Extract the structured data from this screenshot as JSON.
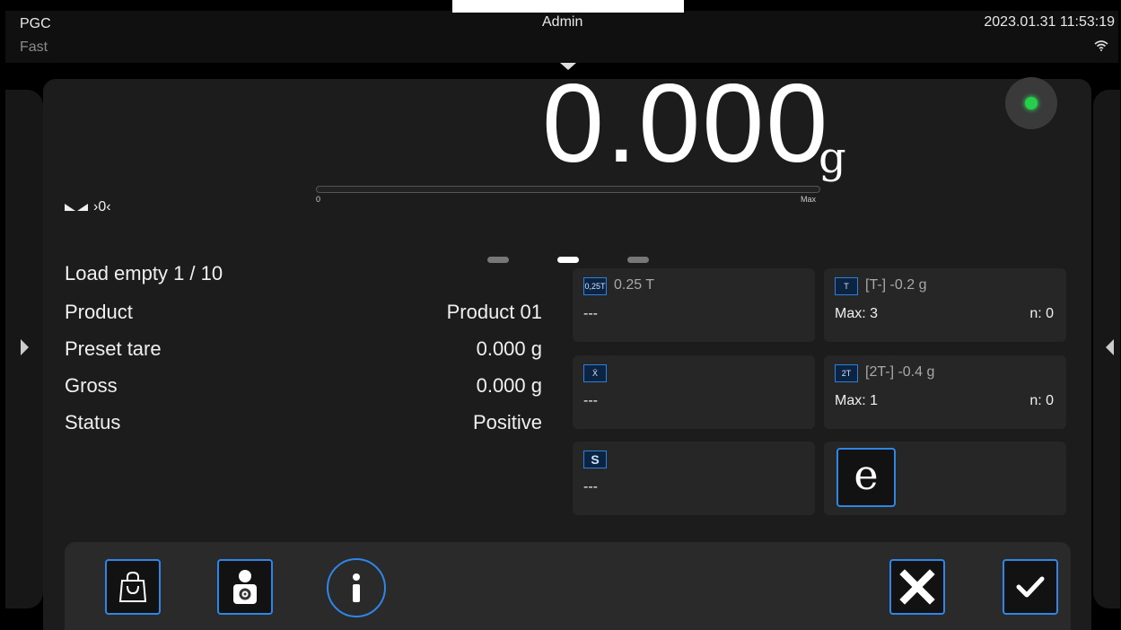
{
  "status": {
    "mode": "PGC",
    "speed": "Fast",
    "user": "Admin",
    "datetime": "2023.01.31 11:53:19"
  },
  "weighing": {
    "value": "0.000",
    "unit": "g",
    "stability_text": "›0‹",
    "bar_min": "0",
    "bar_max": "Max",
    "bar_fill_fraction": 0
  },
  "info": [
    {
      "label": "Load empty 1 / 10",
      "value": ""
    },
    {
      "label": "Product",
      "value": "Product 01"
    },
    {
      "label": "Preset tare",
      "value": "0.000 g"
    },
    {
      "label": "Gross",
      "value": "0.000 g"
    },
    {
      "label": "Status",
      "value": "Positive"
    }
  ],
  "widgets": {
    "tare_limit": {
      "icon_text": "0,25T",
      "header": "0.25 T",
      "value": "---"
    },
    "t_minus": {
      "icon_text": "T",
      "header": "[T-]   -0.2 g",
      "max": "Max: 3",
      "n": "n: 0"
    },
    "mean": {
      "icon_text": "X̄",
      "header": "",
      "value": "---"
    },
    "two_t_minus": {
      "icon_text": "2T",
      "header": "[2T-]   -0.4 g",
      "max": "Max: 1",
      "n": "n: 0"
    },
    "stddev": {
      "icon_text": "S",
      "header": "",
      "value": "---"
    },
    "e_mark": {
      "icon_text": "e"
    }
  },
  "colors": {
    "accent": "#2e86e6",
    "led": "#26d04a",
    "background": "#000000"
  },
  "icons": [
    "wifi-icon",
    "product-bag-icon",
    "operator-settings-icon",
    "info-icon",
    "cancel-icon",
    "confirm-icon"
  ]
}
